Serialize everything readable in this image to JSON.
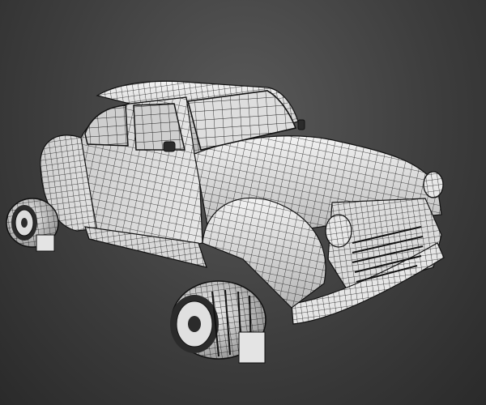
{
  "scene": {
    "subject": "car-3d-wireframe-model",
    "colors": {
      "background_center": "#5a5a5a",
      "background_edge": "#2a2a2a",
      "surface": "#e9e9e9",
      "surface_shadow": "#9c9c9c",
      "wire": "#1a1a1a",
      "detail_dark": "#2b2b2b"
    }
  }
}
